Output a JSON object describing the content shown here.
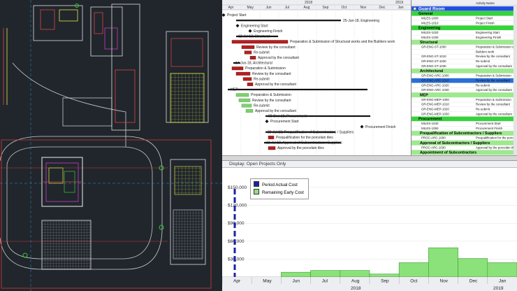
{
  "gantt": {
    "year_left": "2018",
    "year_right": "2019",
    "months": [
      "Apr",
      "May",
      "Jun",
      "Jul",
      "Aug",
      "Sep",
      "Oct",
      "Nov",
      "Dec",
      "Jan"
    ],
    "tasks": [
      {
        "label": "Project Start",
        "type": "milestone"
      },
      {
        "label": "25-Jun-18, Engineering",
        "type": "summary"
      },
      {
        "label": "Engineering Start",
        "type": "milestone"
      },
      {
        "label": "Engineering Finish",
        "type": "milestone"
      },
      {
        "label": "12-Jul-18, Structural",
        "type": "summary"
      },
      {
        "label": "Preparation & Submission of Structural works and the Builders work",
        "type": "red"
      },
      {
        "label": "Review by the consultant",
        "type": "red"
      },
      {
        "label": "Re-submit",
        "type": "red"
      },
      {
        "label": "Approval by the consultant",
        "type": "red"
      },
      {
        "label": "14-Jun-18, Architectural",
        "type": "summary"
      },
      {
        "label": "Preparation & Submission",
        "type": "red"
      },
      {
        "label": "Review by the consultant",
        "type": "red"
      },
      {
        "label": "Re-submit",
        "type": "red"
      },
      {
        "label": "Approval by the consultant",
        "type": "red"
      },
      {
        "label": "MEP",
        "type": "summary"
      },
      {
        "label": "Preparation & Submission",
        "type": "green"
      },
      {
        "label": "Review by the consultant",
        "type": "green"
      },
      {
        "label": "Re-submit",
        "type": "green"
      },
      {
        "label": "Approval by the consultant",
        "type": "green"
      },
      {
        "label": "08-Dec-18, Procurement",
        "type": "summary"
      },
      {
        "label": "Procurement Start",
        "type": "milestone"
      },
      {
        "label": "Procurement Finish",
        "type": "milestone"
      },
      {
        "label": "29-Jul-18, Prequalification of Subcontractors / Suppliers",
        "type": "summary"
      },
      {
        "label": "Prequalification for the porcelain tiles",
        "type": "red"
      },
      {
        "label": "12-Jul-18, Approval of Subcontractors / Suppliers",
        "type": "summary"
      },
      {
        "label": "Approval by the porcelain tiles",
        "type": "red"
      }
    ]
  },
  "activities": {
    "column_header": "Activity Name",
    "rows": [
      {
        "kind": "project",
        "id": "Guard Room",
        "name": ""
      },
      {
        "kind": "group",
        "id": "General",
        "name": ""
      },
      {
        "kind": "item",
        "id": "MILES-1000",
        "name": "Project Start"
      },
      {
        "kind": "item",
        "id": "MILES-1010",
        "name": "Project Finish"
      },
      {
        "kind": "group",
        "id": "Engineering",
        "name": ""
      },
      {
        "kind": "item",
        "id": "MILES-1020",
        "name": "Engineering Start"
      },
      {
        "kind": "item",
        "id": "MILES-1030",
        "name": "Engineering Finish"
      },
      {
        "kind": "sub",
        "id": "Structural",
        "name": ""
      },
      {
        "kind": "item2",
        "id": "GR-ENG-ST-1000",
        "name": "Preparation & Submission of St"
      },
      {
        "kind": "item2",
        "id": "",
        "name": "Builders work"
      },
      {
        "kind": "item",
        "id": "GR-ENG-ST-1010",
        "name": "Review by the consultant"
      },
      {
        "kind": "item",
        "id": "GR-ENG-ST-1020",
        "name": "Re-submit"
      },
      {
        "kind": "item",
        "id": "GR-ENG-ST-1030",
        "name": "Approval by the consultant"
      },
      {
        "kind": "sub",
        "id": "Architectural",
        "name": ""
      },
      {
        "kind": "item",
        "id": "GR-ENG-ARC-1000",
        "name": "Preparation & Submission"
      },
      {
        "kind": "selected",
        "id": "GR-ENG-ARC-1010",
        "name": "Review by the consultant"
      },
      {
        "kind": "item",
        "id": "GR-ENG-ARC-1020",
        "name": "Re-submit"
      },
      {
        "kind": "item",
        "id": "GR-ENG-ARC-1030",
        "name": "Approval by the consultant"
      },
      {
        "kind": "sub",
        "id": "MEP",
        "name": ""
      },
      {
        "kind": "item",
        "id": "GR-ENG-MEP-1000",
        "name": "Preparation & Submission"
      },
      {
        "kind": "item",
        "id": "GR-ENG-MEP-1010",
        "name": "Review by the consultant"
      },
      {
        "kind": "item",
        "id": "GR-ENG-MEP-1020",
        "name": "Re-submit"
      },
      {
        "kind": "item",
        "id": "GR-ENG-MEP-1030",
        "name": "Approval by the consultant"
      },
      {
        "kind": "group",
        "id": "Procurement",
        "name": ""
      },
      {
        "kind": "item",
        "id": "MILES-1040",
        "name": "Procurement Start"
      },
      {
        "kind": "item",
        "id": "MILES-1050",
        "name": "Procurement Finish"
      },
      {
        "kind": "sub",
        "id": "Prequalification of Subcontractors / Suppliers",
        "name": ""
      },
      {
        "kind": "item",
        "id": "PROC-ARC-1000",
        "name": "Prequalification for the porcel"
      },
      {
        "kind": "sub",
        "id": "Approval of Subcontractors / Suppliers",
        "name": ""
      },
      {
        "kind": "item",
        "id": "PROC-ARC-1030",
        "name": "Approval by the porcelain tiles"
      },
      {
        "kind": "sub",
        "id": "Appointment of Subcontractors",
        "name": ""
      }
    ]
  },
  "histogram": {
    "display_label": "Display: Open Projects Only",
    "legend": [
      {
        "label": "Period Actual Cost",
        "color": "#1f1fa8"
      },
      {
        "label": "Remaining Early Cost",
        "color": "#8be27a"
      }
    ],
    "colors": {
      "remaining": "#8be27a",
      "actual": "#1f1fa8"
    },
    "year_left": "2018",
    "year_right": "2019"
  },
  "chart_data": {
    "type": "bar",
    "categories": [
      "Apr",
      "May",
      "Jun",
      "Jul",
      "Aug",
      "Sep",
      "Oct",
      "Nov",
      "Dec",
      "Jan"
    ],
    "series": [
      {
        "name": "Remaining Early Cost",
        "values": [
          0,
          0,
          8000,
          11000,
          11000,
          5000,
          24000,
          49000,
          31000,
          24000
        ]
      }
    ],
    "yticks": [
      "$30,000",
      "$60,000",
      "$90,000",
      "$120,000",
      "$150,000"
    ],
    "ylim": [
      0,
      150000
    ],
    "title": "",
    "xlabel": "",
    "ylabel": ""
  }
}
